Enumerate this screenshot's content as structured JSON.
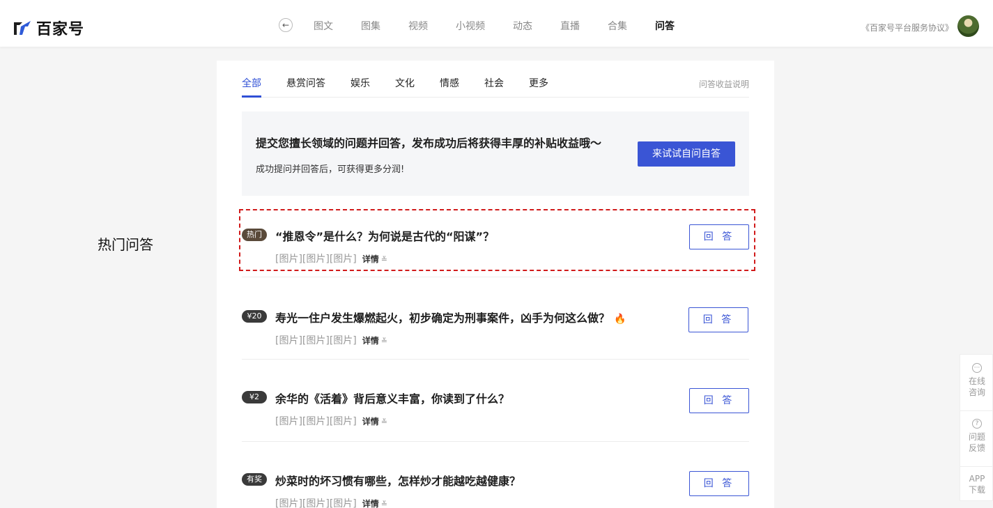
{
  "header": {
    "logo_text": "百家号",
    "back_icon": "arrow-left-icon",
    "nav": [
      "图文",
      "图集",
      "视频",
      "小视频",
      "动态",
      "直播",
      "合集",
      "问答"
    ],
    "nav_active": "问答",
    "agreement": "《百家号平台服务协议》"
  },
  "side_title": "热门问答",
  "tabs": {
    "items": [
      "全部",
      "悬赏问答",
      "娱乐",
      "文化",
      "情感",
      "社会",
      "更多"
    ],
    "active": "全部",
    "explain": "问答收益说明"
  },
  "promo": {
    "title": "提交您擅长领域的问题并回答，发布成功后将获得丰厚的补贴收益哦～",
    "subtitle": "成功提问并回答后，可获得更多分润!",
    "button": "来试试自问自答"
  },
  "questions": [
    {
      "badge": "热门",
      "title": "“推恩令”是什么？为何说是古代的“阳谋”？",
      "meta": "[图片][图片][图片]",
      "detail": "详情",
      "button": "回 答",
      "fire": false
    },
    {
      "badge": "¥20",
      "title": "寿光一住户发生爆燃起火，初步确定为刑事案件，凶手为何这么做？",
      "meta": "[图片][图片][图片]",
      "detail": "详情",
      "button": "回 答",
      "fire": true
    },
    {
      "badge": "¥2",
      "title": "余华的《活着》背后意义丰富，你读到了什么？",
      "meta": "[图片][图片][图片]",
      "detail": "详情",
      "button": "回 答",
      "fire": false
    },
    {
      "badge": "有奖",
      "title": "炒菜时的坏习惯有哪些，怎样炒才能越吃越健康？",
      "meta": "[图片][图片][图片]",
      "detail": "详情",
      "button": "回 答",
      "fire": false
    }
  ],
  "float_bar": {
    "consult": "在线咨询",
    "feedback": "问题反馈",
    "app": "APP下载"
  }
}
